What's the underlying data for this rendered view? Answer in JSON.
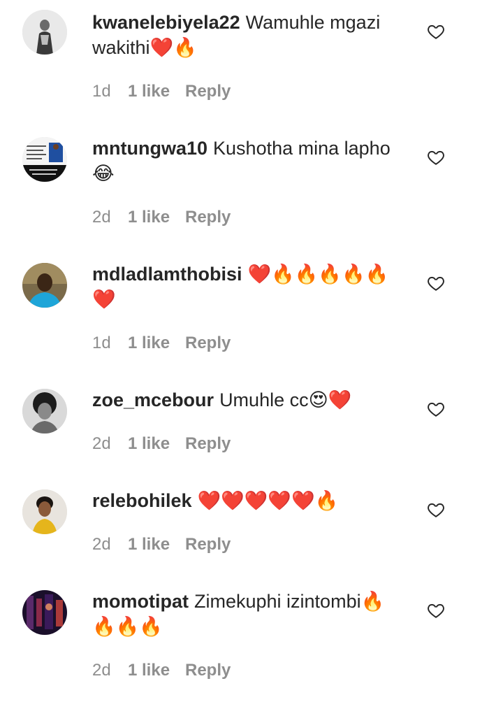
{
  "comments": [
    {
      "username": "kwanelebiyela22",
      "text": "Wamuhle mgazi wakithi❤️🔥",
      "time": "1d",
      "likes": "1 like",
      "reply": "Reply"
    },
    {
      "username": "mntungwa10",
      "text": "Kushotha mina lapho 😂",
      "time": "2d",
      "likes": "1 like",
      "reply": "Reply"
    },
    {
      "username": "mdladlamthobisi",
      "text": "❤️🔥🔥🔥🔥🔥❤️",
      "time": "1d",
      "likes": "1 like",
      "reply": "Reply"
    },
    {
      "username": "zoe_mcebour",
      "text": "Umuhle cc😍❤️",
      "time": "2d",
      "likes": "1 like",
      "reply": "Reply"
    },
    {
      "username": "relebohilek",
      "text": "❤️❤️❤️❤️❤️🔥",
      "time": "2d",
      "likes": "1 like",
      "reply": "Reply"
    },
    {
      "username": "momotipat",
      "text": "Zimekuphi izintombi🔥🔥🔥🔥",
      "time": "2d",
      "likes": "1 like",
      "reply": "Reply"
    }
  ]
}
